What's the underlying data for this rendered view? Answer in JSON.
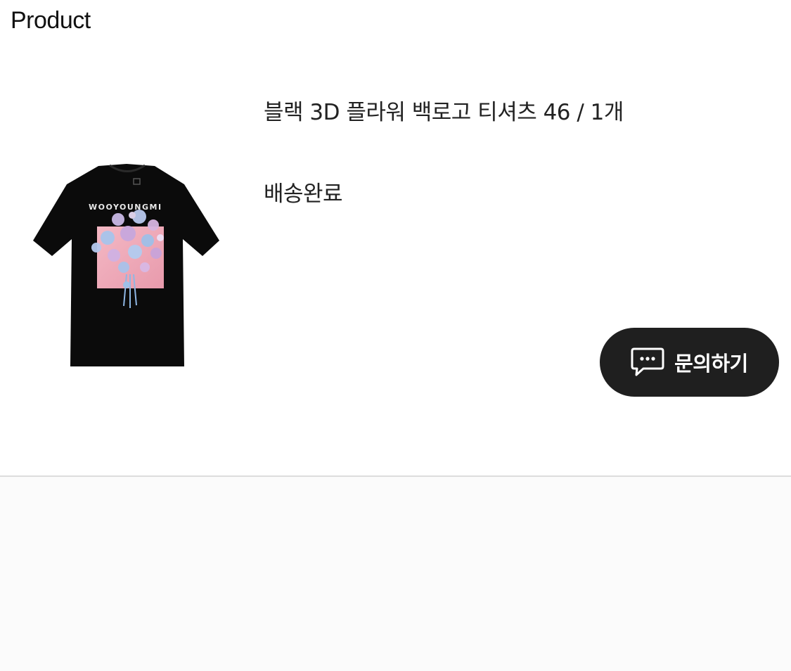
{
  "section": {
    "title": "Product"
  },
  "order_item": {
    "product_name": "블랙 3D 플라워 백로고 티셔츠 46 / 1개",
    "delivery_status": "배송완료",
    "image": {
      "icon": "t-shirt-product-image",
      "brand_print": "WOOYOUNGMI"
    },
    "inquiry_button": {
      "label": "문의하기",
      "icon": "chat-bubble-icon"
    }
  }
}
